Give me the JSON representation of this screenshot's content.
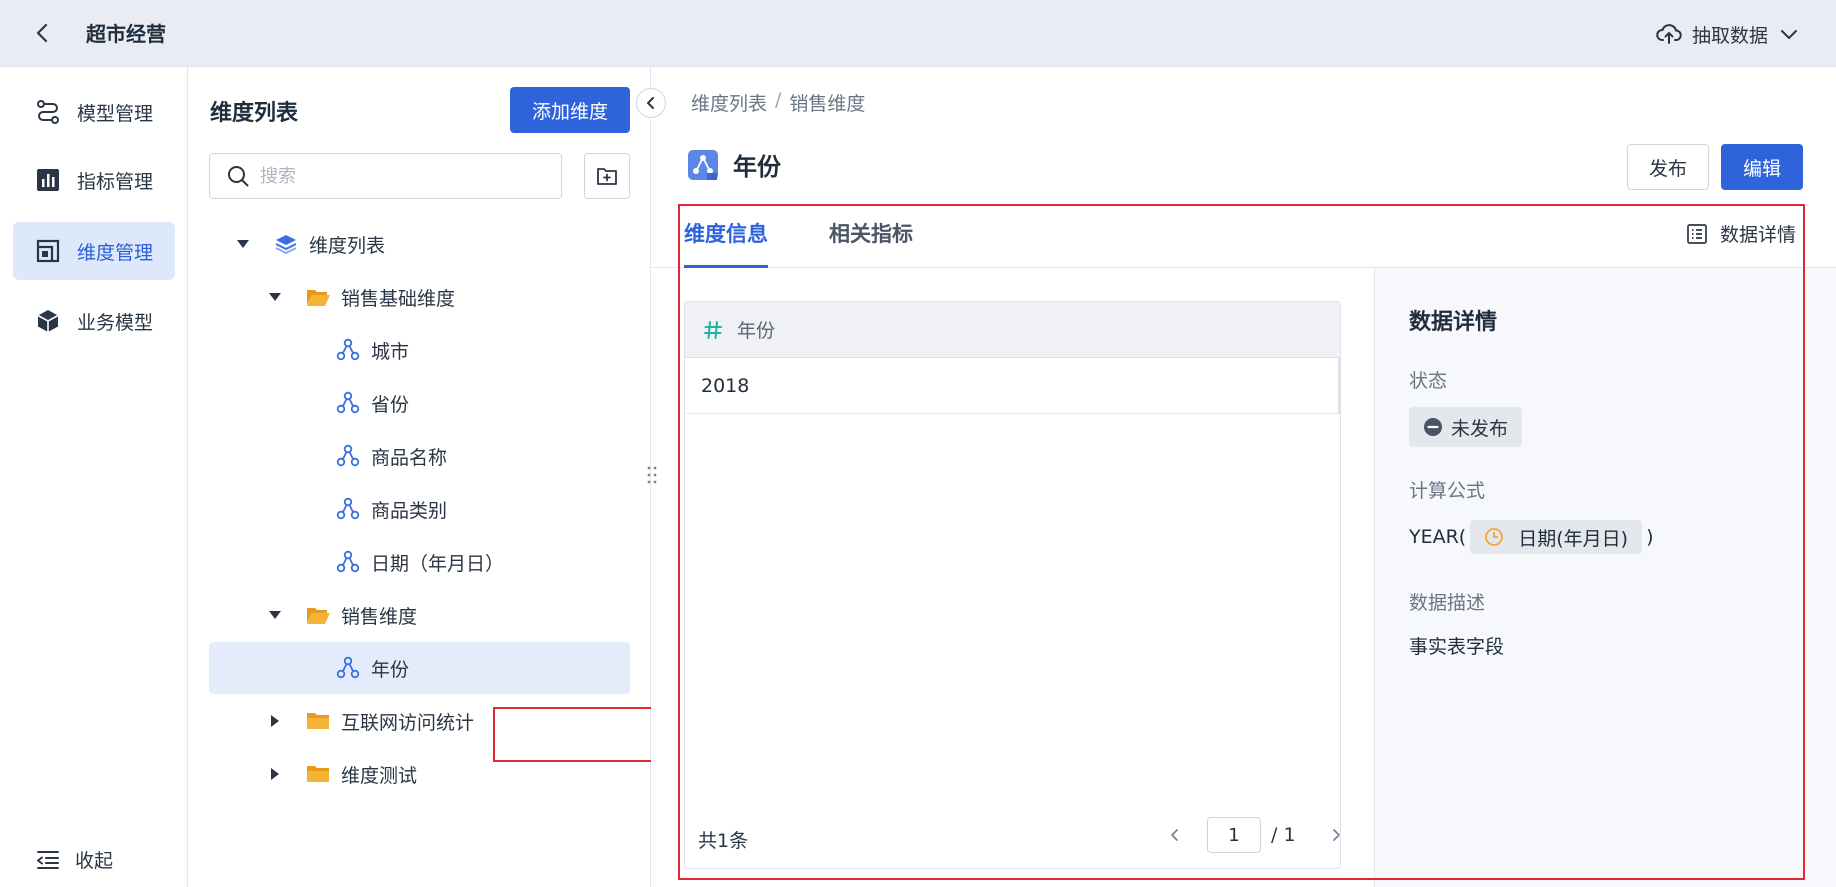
{
  "header": {
    "app_title": "超市经营",
    "extract_label": "抽取数据"
  },
  "sidenav": {
    "items": [
      {
        "label": "模型管理",
        "icon": "model-flow-icon"
      },
      {
        "label": "指标管理",
        "icon": "bar-chart-icon"
      },
      {
        "label": "维度管理",
        "icon": "dimension-icon",
        "active": true
      },
      {
        "label": "业务模型",
        "icon": "cube-icon"
      }
    ],
    "collapse_label": "收起"
  },
  "tree": {
    "title": "维度列表",
    "add_button": "添加维度",
    "search_placeholder": "搜索",
    "root": "维度列表",
    "folders": [
      {
        "label": "销售基础维度",
        "expanded": true,
        "children": [
          "城市",
          "省份",
          "商品名称",
          "商品类别",
          "日期（年月日）"
        ]
      },
      {
        "label": "销售维度",
        "expanded": true,
        "children": [
          "年份"
        ]
      },
      {
        "label": "互联网访问统计",
        "expanded": false
      },
      {
        "label": "维度测试",
        "expanded": false
      }
    ],
    "selected": "年份"
  },
  "detail": {
    "breadcrumb": [
      "维度列表",
      "销售维度"
    ],
    "title": "年份",
    "publish_button": "发布",
    "edit_button": "编辑",
    "tabs": [
      {
        "label": "维度信息",
        "active": true
      },
      {
        "label": "相关指标",
        "active": false
      }
    ],
    "data_detail_toggle": "数据详情",
    "table": {
      "column": "年份",
      "rows": [
        "2018"
      ]
    },
    "total_count": "共1条",
    "pager": {
      "current": "1",
      "total": "/ 1"
    },
    "side": {
      "title": "数据详情",
      "status_label": "状态",
      "status_value": "未发布",
      "formula_label": "计算公式",
      "formula_prefix": "YEAR(",
      "formula_field": "日期(年月日)",
      "formula_suffix": ")",
      "desc_label": "数据描述",
      "desc_value": "事实表字段"
    }
  },
  "colors": {
    "primary": "#2f63dc",
    "highlight_border": "#e3262f",
    "folder": "#f5b335",
    "selected_row": "#e4ecfb"
  }
}
